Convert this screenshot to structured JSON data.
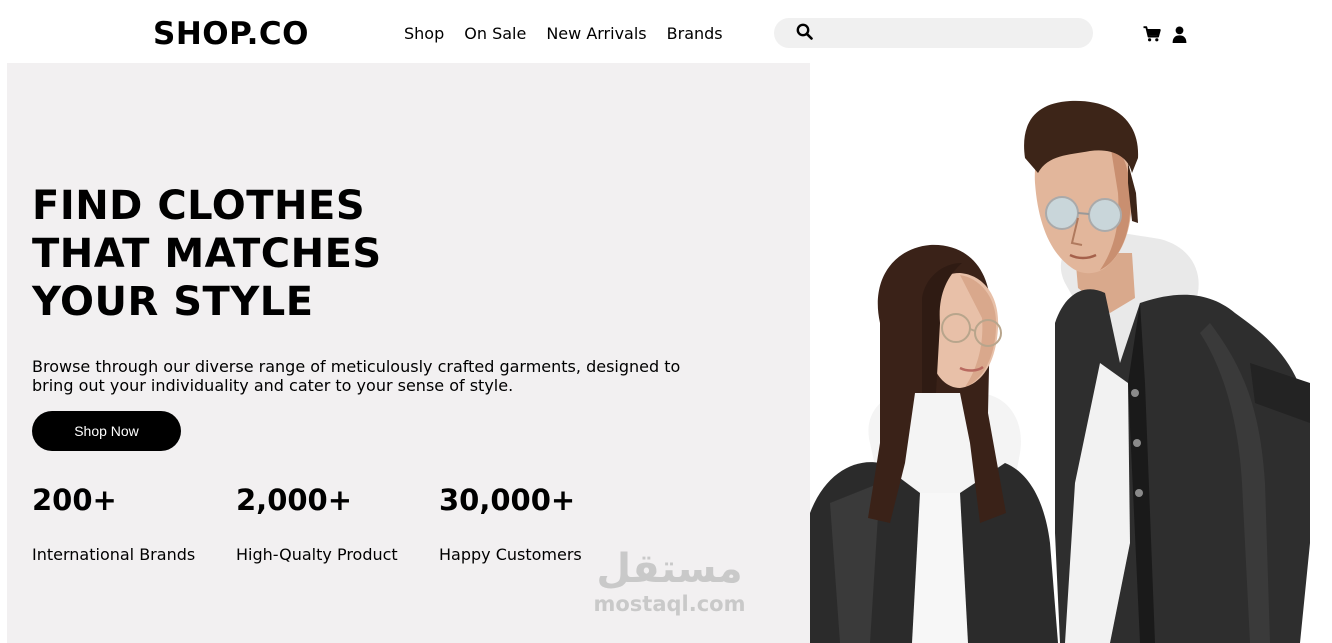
{
  "header": {
    "logo": "SHOP.CO",
    "nav": [
      "Shop",
      "On Sale",
      "New Arrivals",
      "Brands"
    ],
    "search_placeholder": "",
    "icons": [
      "search-icon",
      "cart-icon",
      "user-icon"
    ]
  },
  "hero": {
    "headline": [
      "FIND CLOTHES",
      "THAT MATCHES",
      "YOUR STYLE"
    ],
    "description": "Browse through our diverse range of meticulously crafted garments, designed to bring out your individuality and cater to your sense of style.",
    "cta": "Shop Now",
    "stats": [
      {
        "value": "200+",
        "label": "International Brands"
      },
      {
        "value": "2,000+",
        "label": "High-Qualty Product"
      },
      {
        "value": "30,000+",
        "label": "Happy Customers"
      }
    ],
    "image_alt": "couple wearing denim jackets and white hoodies",
    "watermark": {
      "arabic": "مستقل",
      "latin": "mostaql.com"
    }
  },
  "colors": {
    "hero_bg": "#f2f0f1",
    "search_bg": "#f0f0f0",
    "button_bg": "#000000",
    "text": "#000000"
  }
}
